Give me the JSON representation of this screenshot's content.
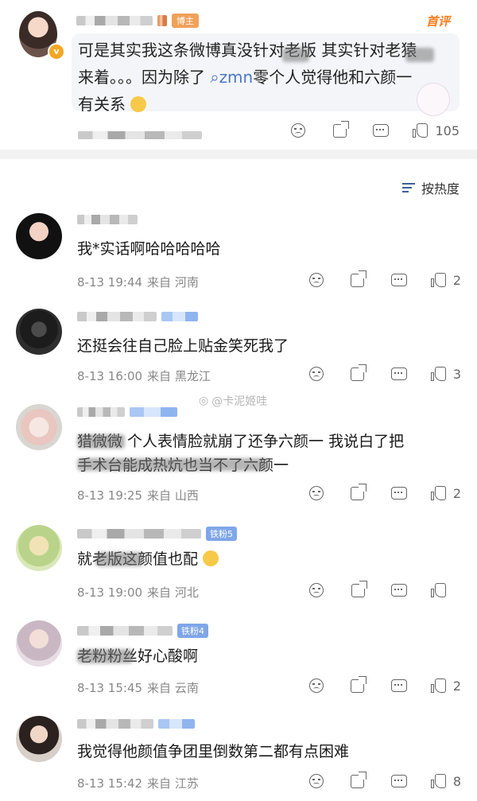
{
  "top_comment": {
    "author_badge": "博主",
    "first_comment_label": "首评",
    "text_line1": "可是其实我这条微博真没针对老版 其实针对老猿",
    "text_line2": "来着。。。因为除了",
    "mention": "zmn",
    "text_line2_b": "零个人觉得他和六颜一",
    "text_line3": "有关系",
    "likes": "105"
  },
  "sort": {
    "label": "按热度"
  },
  "watermark": {
    "text": "@卡泥姬哇"
  },
  "comments": [
    {
      "text": "我*实话啊哈哈哈哈哈",
      "date": "8-13 19:44",
      "location": "来自 河南",
      "likes": "2"
    },
    {
      "text": "还挺会往自己脸上贴金笑死我了",
      "date": "8-13 16:00",
      "location": "来自 黑龙江",
      "likes": "3"
    },
    {
      "text_line1": "猎微微 个人表情脸就崩了还争六颜一 我说白了把",
      "text_line2": "手术台能成热炕也当不了六颜一",
      "date": "8-13 19:25",
      "location": "来自 山西",
      "likes": "2"
    },
    {
      "badge": "铁粉5",
      "text": "就老版这颜值也配",
      "date": "8-13 19:00",
      "location": "来自 河北",
      "likes": ""
    },
    {
      "badge": "铁粉4",
      "text": "老粉粉丝好心酸啊",
      "date": "8-13 15:45",
      "location": "来自 云南",
      "likes": "2"
    },
    {
      "text": "我觉得他颜值争团里倒数第二都有点困难",
      "date": "8-13 15:42",
      "location": "来自 江苏",
      "likes": "8"
    }
  ]
}
